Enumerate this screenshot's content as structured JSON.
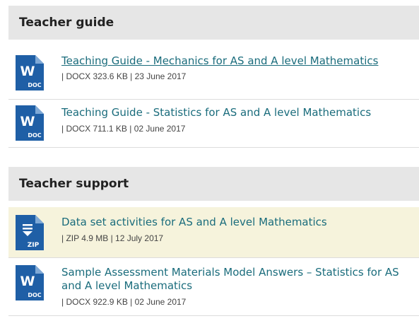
{
  "sections": [
    {
      "heading": "Teacher guide",
      "items": [
        {
          "icon": "word-doc-icon",
          "icon_label": "W",
          "icon_sub": "DOC",
          "title": "Teaching Guide - Mechanics for AS and A level Mathematics",
          "meta": "| DOCX 323.6 KB | 23 June 2017",
          "hovered": true
        },
        {
          "icon": "word-doc-icon",
          "icon_label": "W",
          "icon_sub": "DOC",
          "title": "Teaching Guide - Statistics for AS and A level Mathematics",
          "meta": "| DOCX 711.1 KB | 02 June 2017"
        }
      ]
    },
    {
      "heading": "Teacher support",
      "items": [
        {
          "icon": "zip-file-icon",
          "icon_sub": "ZIP",
          "title": "Data set activities for AS and A level Mathematics",
          "meta": "| ZIP 4.9 MB | 12 July 2017",
          "highlighted": true
        },
        {
          "icon": "word-doc-icon",
          "icon_label": "W",
          "icon_sub": "DOC",
          "title": "Sample Assessment Materials Model Answers – Statistics for AS and A level Mathematics",
          "meta": "| DOCX 922.9 KB | 02 June 2017"
        }
      ]
    }
  ],
  "colors": {
    "icon_blue": "#1f5fa6",
    "link": "#1a6c7c",
    "header_bg": "#e6e6e6",
    "highlight_bg": "#f6f3dc"
  }
}
